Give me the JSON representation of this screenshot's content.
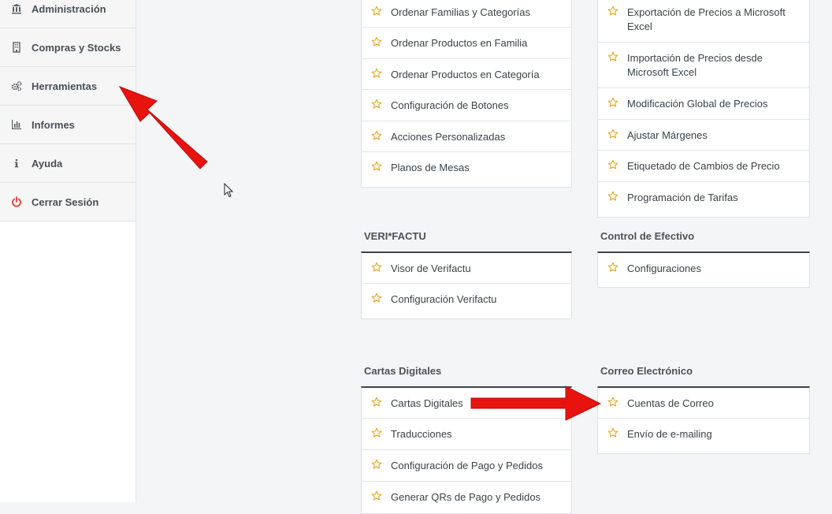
{
  "sidebar": {
    "items": [
      {
        "label": "Administración",
        "icon": "bank-icon"
      },
      {
        "label": "Compras y Stocks",
        "icon": "building-icon"
      },
      {
        "label": "Herramientas",
        "icon": "gears-icon"
      },
      {
        "label": "Informes",
        "icon": "bar-chart-icon"
      },
      {
        "label": "Ayuda",
        "icon": "info-icon"
      },
      {
        "label": "Cerrar Sesión",
        "icon": "power-icon"
      }
    ]
  },
  "colors": {
    "star": "#e8a622",
    "arrow": "#e8130f",
    "power": "#e53935",
    "section_border": "#3d4450"
  },
  "cards": {
    "left_top": {
      "items": [
        "Ordenar Familias y Categorías",
        "Ordenar Productos en Familia",
        "Ordenar Productos en Categoría",
        "Configuración de Botones",
        "Acciones Personalizadas",
        "Planos de Mesas"
      ]
    },
    "right_top": {
      "items": [
        "Exportación de Precios a Microsoft Excel",
        "Importación de Precios desde Microsoft Excel",
        "Modificación Global de Precios",
        "Ajustar Márgenes",
        "Etiquetado de Cambios de Precio",
        "Programación de Tarifas"
      ]
    },
    "verifactu": {
      "title": "VERI*FACTU",
      "items": [
        "Visor de Verifactu",
        "Configuración Verifactu"
      ]
    },
    "control_efectivo": {
      "title": "Control de Efectivo",
      "items": [
        "Configuraciones"
      ]
    },
    "cartas_digitales": {
      "title": "Cartas Digitales",
      "items": [
        "Cartas Digitales",
        "Traducciones",
        "Configuración de Pago y Pedidos",
        "Generar QRs de Pago y Pedidos"
      ]
    },
    "correo": {
      "title": "Correo Electrónico",
      "items": [
        "Cuentas de Correo",
        "Envío de e-mailing"
      ]
    }
  }
}
